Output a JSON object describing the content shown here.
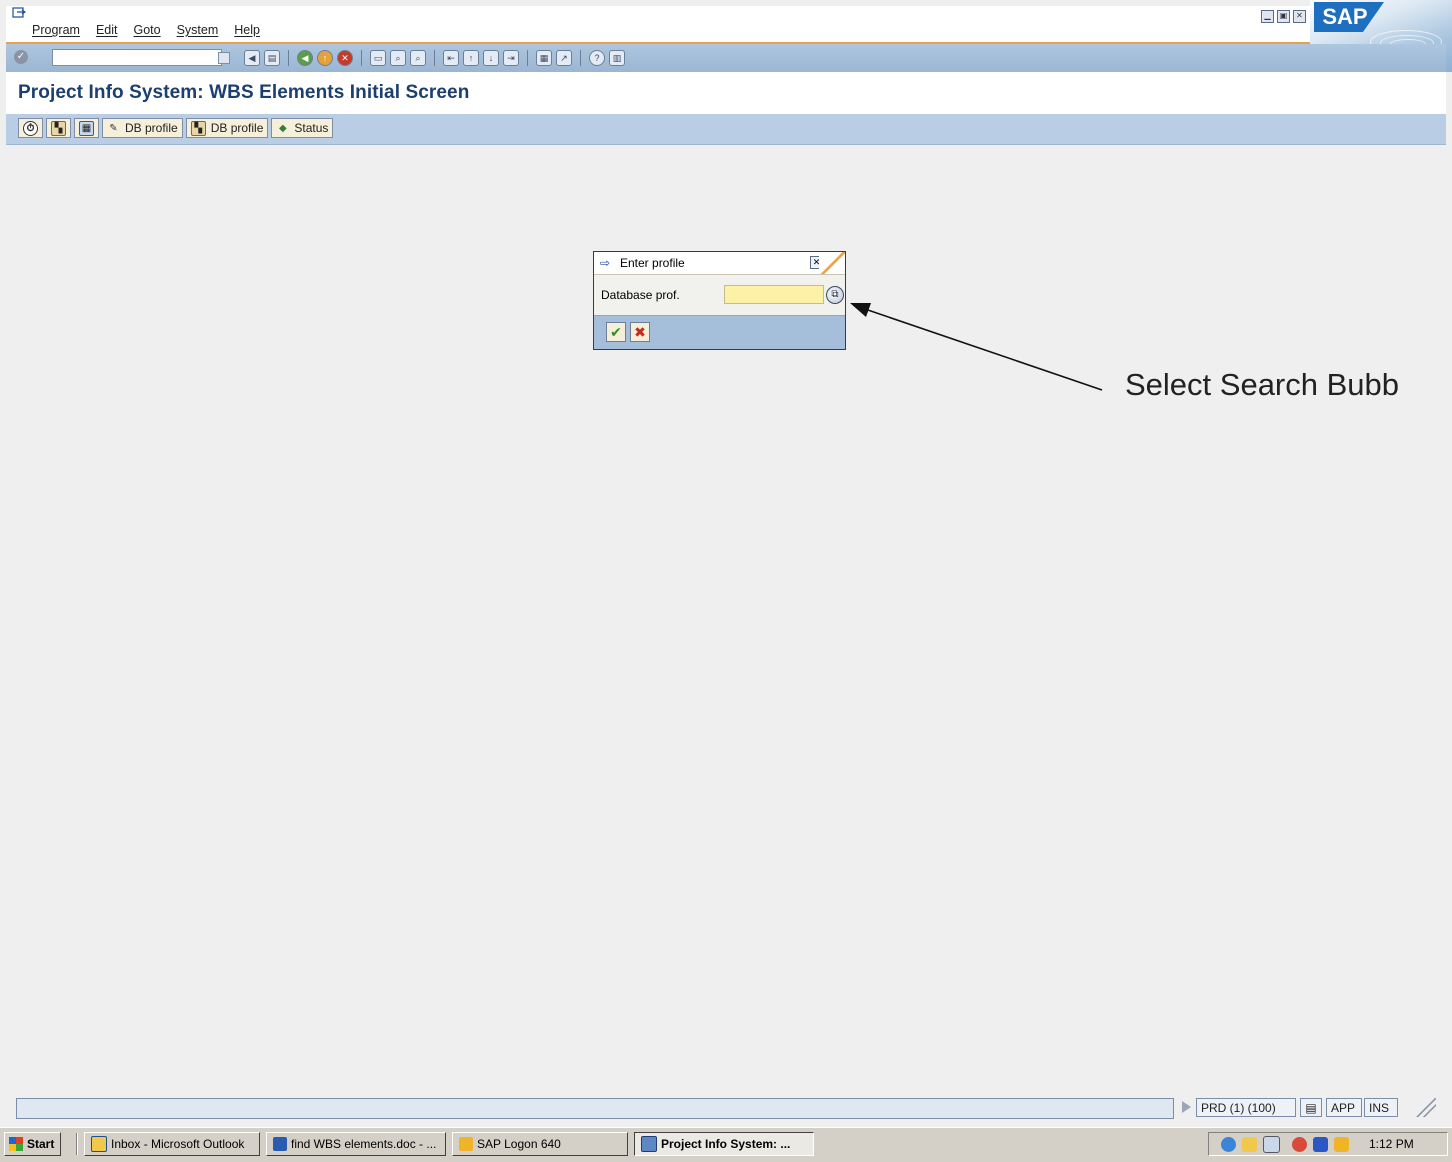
{
  "menubar": {
    "items": [
      "Program",
      "Edit",
      "Goto",
      "System",
      "Help"
    ],
    "window_controls": [
      "minimize-icon",
      "maximize-icon",
      "close-icon"
    ],
    "logo_text": "SAP"
  },
  "std_toolbar": {
    "command_field_value": "",
    "tool_icons": [
      "enter-icon",
      "back-icon",
      "save-icon",
      "back-nav-icon",
      "exit-icon",
      "cancel-icon",
      "print-icon",
      "find-icon",
      "find-next-icon",
      "first-page-icon",
      "prev-page-icon",
      "next-page-icon",
      "last-page-icon",
      "new-session-icon",
      "shortcut-icon",
      "help-icon",
      "layout-icon"
    ]
  },
  "title": "Project Info System: WBS Elements Initial Screen",
  "app_toolbar": {
    "buttons": [
      {
        "label": "",
        "icon": "execute-icon"
      },
      {
        "label": "",
        "icon": "new-selection-icon"
      },
      {
        "label": "",
        "icon": "overview-icon"
      },
      {
        "label": "DB profile",
        "icon": "pencil-icon"
      },
      {
        "label": "DB profile",
        "icon": "profile-icon"
      },
      {
        "label": "Status",
        "icon": "status-icon"
      }
    ]
  },
  "dialog": {
    "title": "Enter profile",
    "field_label": "Database prof.",
    "field_value": "",
    "ok_icon": "checkmark-icon",
    "cancel_icon": "cancel-x-icon"
  },
  "annotation": "Select Search Bubb",
  "statusbar": {
    "message": "",
    "system": "PRD (1) (100)",
    "server": "APP",
    "mode": "INS"
  },
  "taskbar": {
    "start_label": "Start",
    "tasks": [
      {
        "label": "Inbox - Microsoft Outlook",
        "icon": "outlook-icon"
      },
      {
        "label": "find WBS elements.doc - ...",
        "icon": "word-icon"
      },
      {
        "label": "SAP Logon 640",
        "icon": "sap-logon-icon"
      },
      {
        "label": "Project Info System: ...",
        "icon": "sap-window-icon",
        "active": true
      }
    ],
    "clock": "1:12 PM"
  },
  "colors": {
    "accent_orange": "#e8a24a",
    "title_blue": "#1b3f70",
    "toolbar_blue": "#b9cee5",
    "input_yellow": "#fdf1a8"
  }
}
